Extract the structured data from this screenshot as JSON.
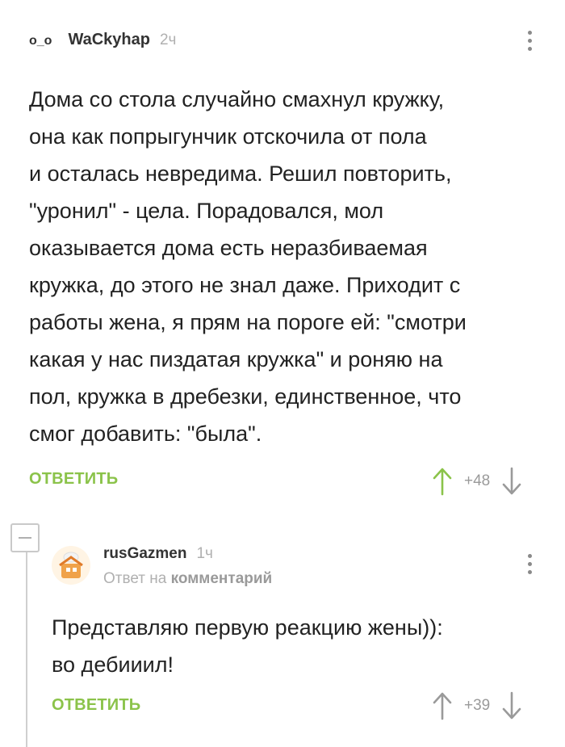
{
  "comment": {
    "avatar_text": "o_o",
    "username": "WaCkyhap",
    "time": "2ч",
    "text": "Дома со стола случайно смахнул кружку,\nона как попрыгунчик отскочила от пола\nи осталась невредима. Решил повторить,\n\"уронил\" - цела. Порадовался, мол\nоказывается дома есть неразбиваемая\nкружка, до этого не знал даже. Приходит с\nработы жена, я прям на пороге ей: \"смотри\nкакая у нас пиздатая кружка\" и роняю на\nпол, кружка в дребезки, единственное, что\nсмог добавить: \"была\".",
    "reply_label": "ОТВЕТИТЬ",
    "score": "+48",
    "upvote_icon": "arrow-up-icon",
    "downvote_icon": "arrow-down-icon",
    "upvote_color": "#8bc34a"
  },
  "reply": {
    "username": "rusGazmen",
    "time": "1ч",
    "reply_prefix": "Ответ на",
    "reply_target": "комментарий",
    "text": "Представляю первую реакцию жены)):\nво дебииил!",
    "reply_label": "ОТВЕТИТЬ",
    "score": "+39",
    "upvote_color": "#9a9a9a"
  },
  "colors": {
    "accent": "#8bc34a",
    "muted": "#b0b0b0"
  }
}
